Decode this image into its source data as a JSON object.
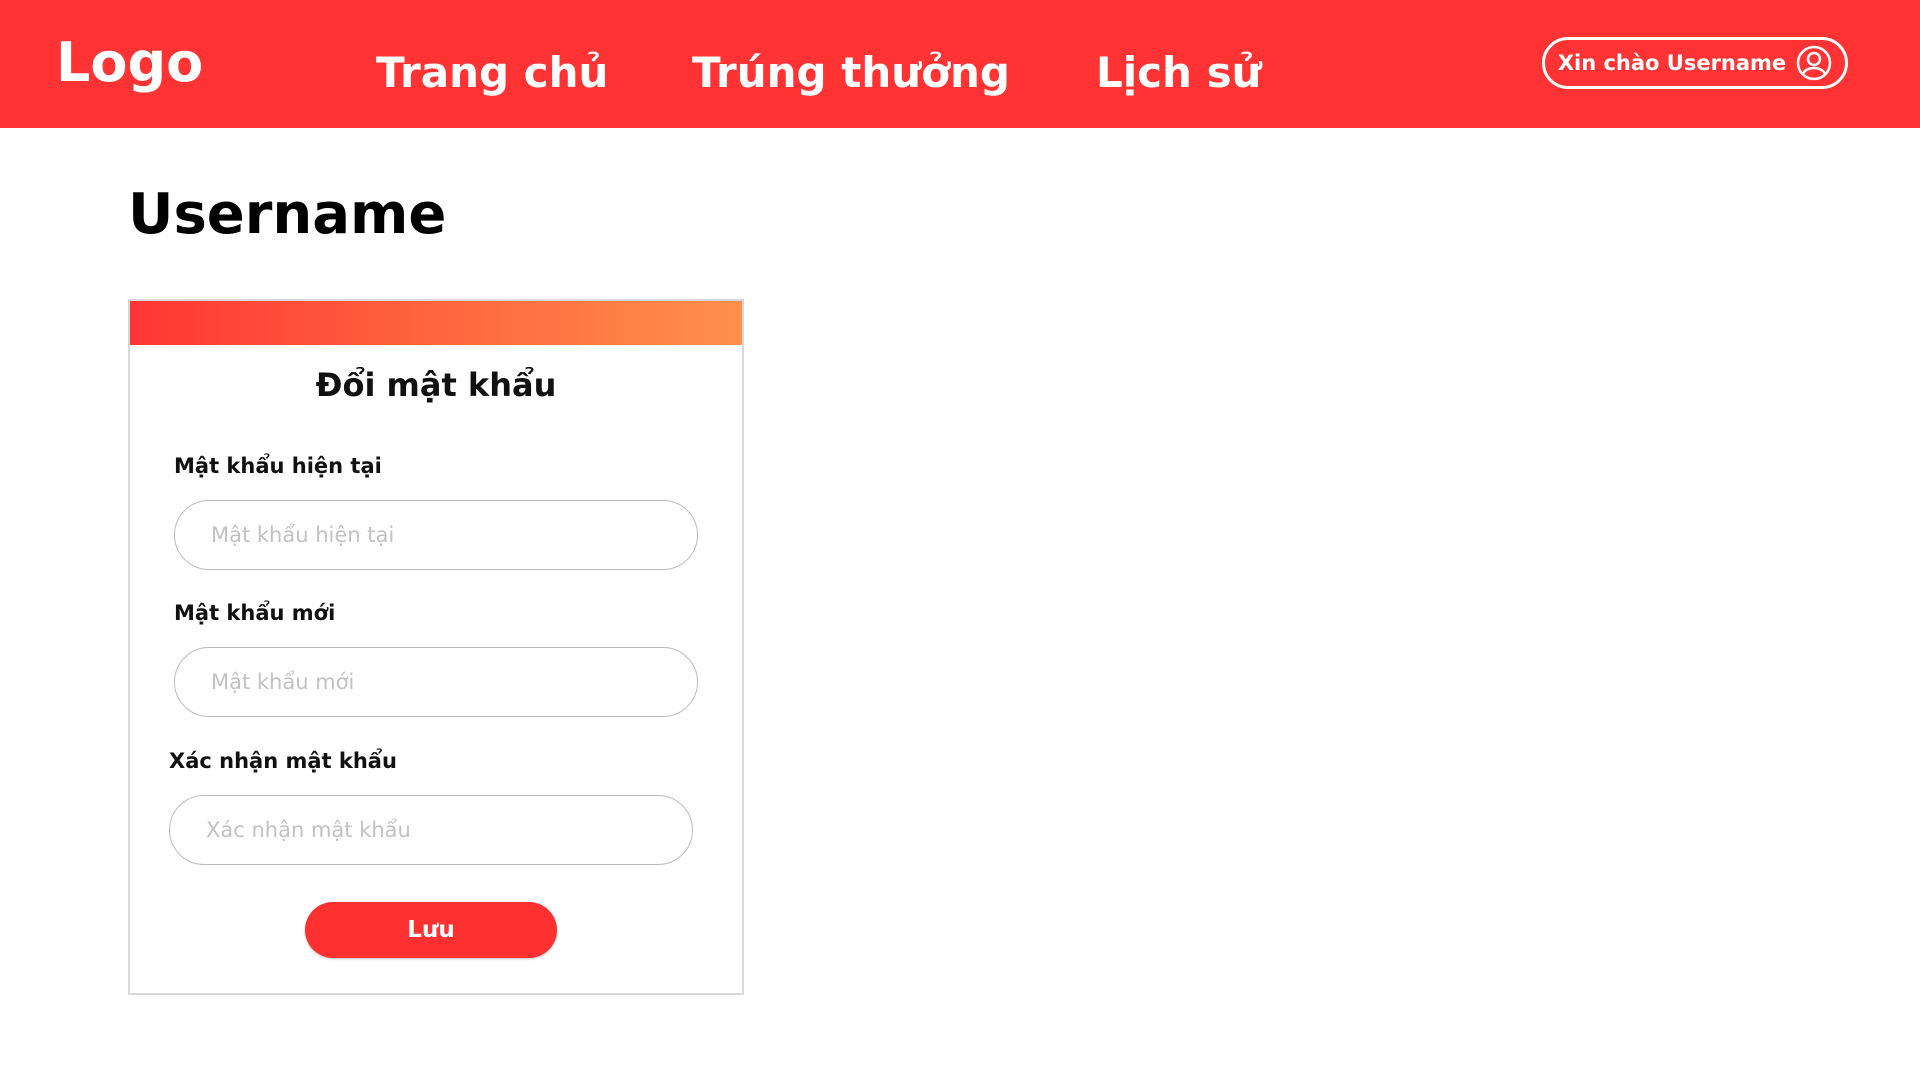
{
  "header": {
    "logo": "Logo",
    "nav": {
      "home": "Trang chủ",
      "prize": "Trúng thưởng",
      "history": "Lịch sử"
    },
    "user_greeting": "Xin chào Username",
    "user_icon": "user-circle-icon"
  },
  "page": {
    "title": "Username"
  },
  "change_password_form": {
    "title": "Đổi mật khẩu",
    "current_password": {
      "label": "Mật khẩu hiện tại",
      "placeholder": "Mật khẩu hiện tại",
      "value": ""
    },
    "new_password": {
      "label": "Mật khẩu mới",
      "placeholder": "Mật khẩu mới",
      "value": ""
    },
    "confirm_password": {
      "label": "Xác nhận mật khẩu",
      "placeholder": "Xác nhận mật khẩu",
      "value": ""
    },
    "save_label": "Lưu"
  },
  "colors": {
    "primary": "#ff3333",
    "gradient_start": "#ff3535",
    "gradient_end": "#ff8f4d"
  }
}
